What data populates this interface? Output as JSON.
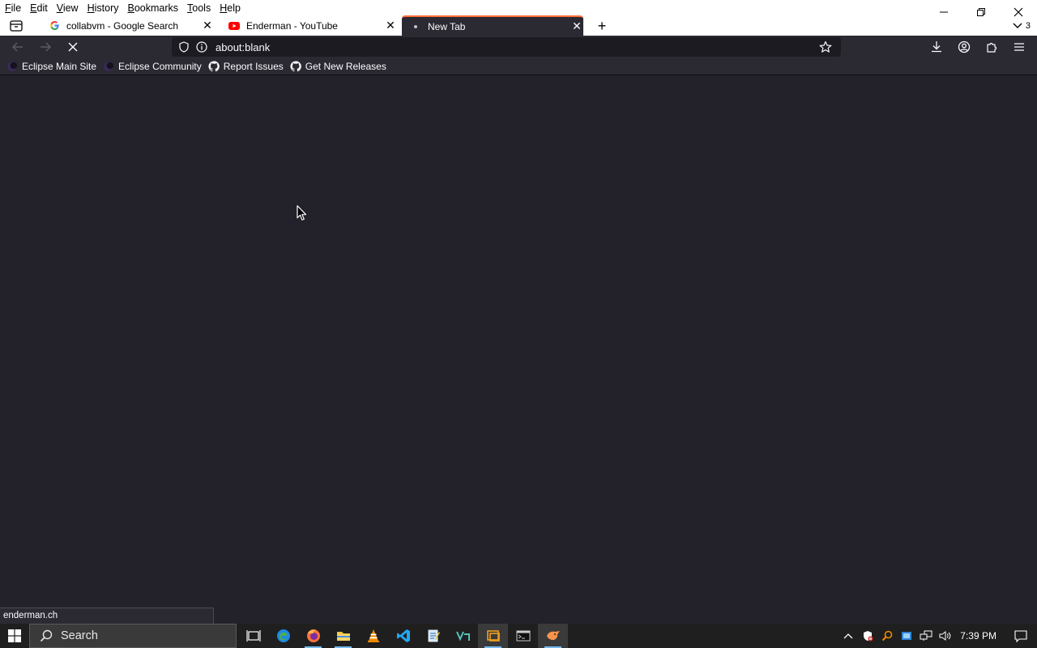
{
  "menubar": {
    "items": [
      {
        "label": "File",
        "accel": "F",
        "rest": "ile"
      },
      {
        "label": "Edit",
        "accel": "E",
        "rest": "dit"
      },
      {
        "label": "View",
        "accel": "V",
        "rest": "iew"
      },
      {
        "label": "History",
        "accel": "H",
        "rest": "istory"
      },
      {
        "label": "Bookmarks",
        "accel": "B",
        "rest": "ookmarks"
      },
      {
        "label": "Tools",
        "accel": "T",
        "rest": "ools"
      },
      {
        "label": "Help",
        "accel": "H",
        "rest": "elp"
      }
    ]
  },
  "tabs": [
    {
      "title": "collabvm - Google Search",
      "icon": "google-icon",
      "active": false
    },
    {
      "title": "Enderman - YouTube",
      "icon": "youtube-icon",
      "active": false
    },
    {
      "title": "New Tab",
      "icon": "loading-dot-icon",
      "active": true
    }
  ],
  "tab_list_count": "3",
  "navbar": {
    "url": "about:blank"
  },
  "bookmarks": [
    {
      "label": "Eclipse Main Site",
      "icon": "eclipse-icon"
    },
    {
      "label": "Eclipse Community",
      "icon": "eclipse-icon"
    },
    {
      "label": "Report Issues",
      "icon": "github-icon"
    },
    {
      "label": "Get New Releases",
      "icon": "github-icon"
    }
  ],
  "status": {
    "text": "enderman.ch"
  },
  "taskbar": {
    "search_placeholder": "Search",
    "clock": "7:39 PM"
  },
  "colors": {
    "accent": "#ff7139",
    "toolbar": "#2b2a33",
    "content": "#23222b",
    "taskbar": "#1f1f1f"
  }
}
